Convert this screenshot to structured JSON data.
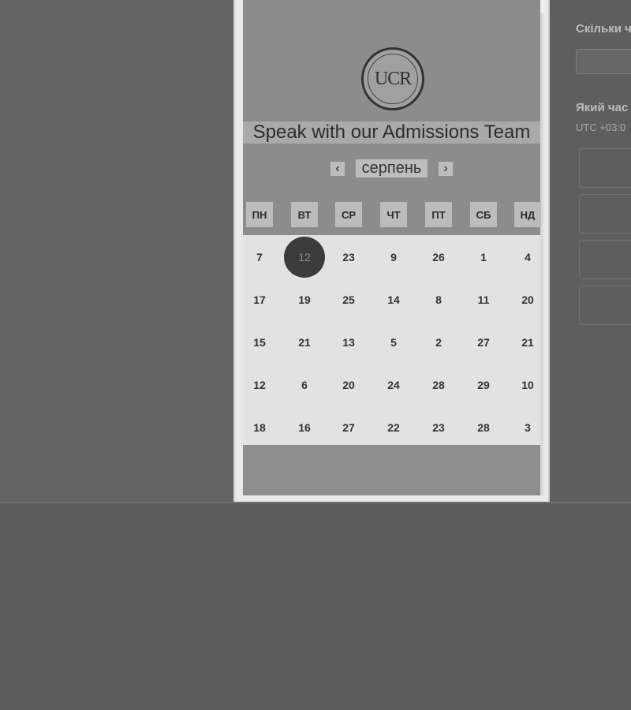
{
  "right_panel": {
    "label_count": "Скільки ч",
    "label_time": "Який час",
    "timezone": "UTC +03:0"
  },
  "modal": {
    "logo_text": "UCR",
    "title": "Speak with our Admissions Team",
    "month_prev_icon": "chevron-left-icon",
    "month": "серпень",
    "month_next_icon": "chevron-right-icon",
    "weekdays": [
      "ПН",
      "ВТ",
      "СР",
      "ЧТ",
      "ПТ",
      "СБ",
      "НД"
    ],
    "weeks": [
      [
        "7",
        "12",
        "23",
        "9",
        "26",
        "1",
        "4"
      ],
      [
        "17",
        "19",
        "25",
        "14",
        "8",
        "11",
        "20"
      ],
      [
        "15",
        "21",
        "13",
        "5",
        "2",
        "27",
        "21"
      ],
      [
        "12",
        "6",
        "20",
        "24",
        "28",
        "29",
        "10"
      ],
      [
        "18",
        "16",
        "27",
        "22",
        "23",
        "28",
        "3"
      ]
    ],
    "selected_day": "12"
  }
}
